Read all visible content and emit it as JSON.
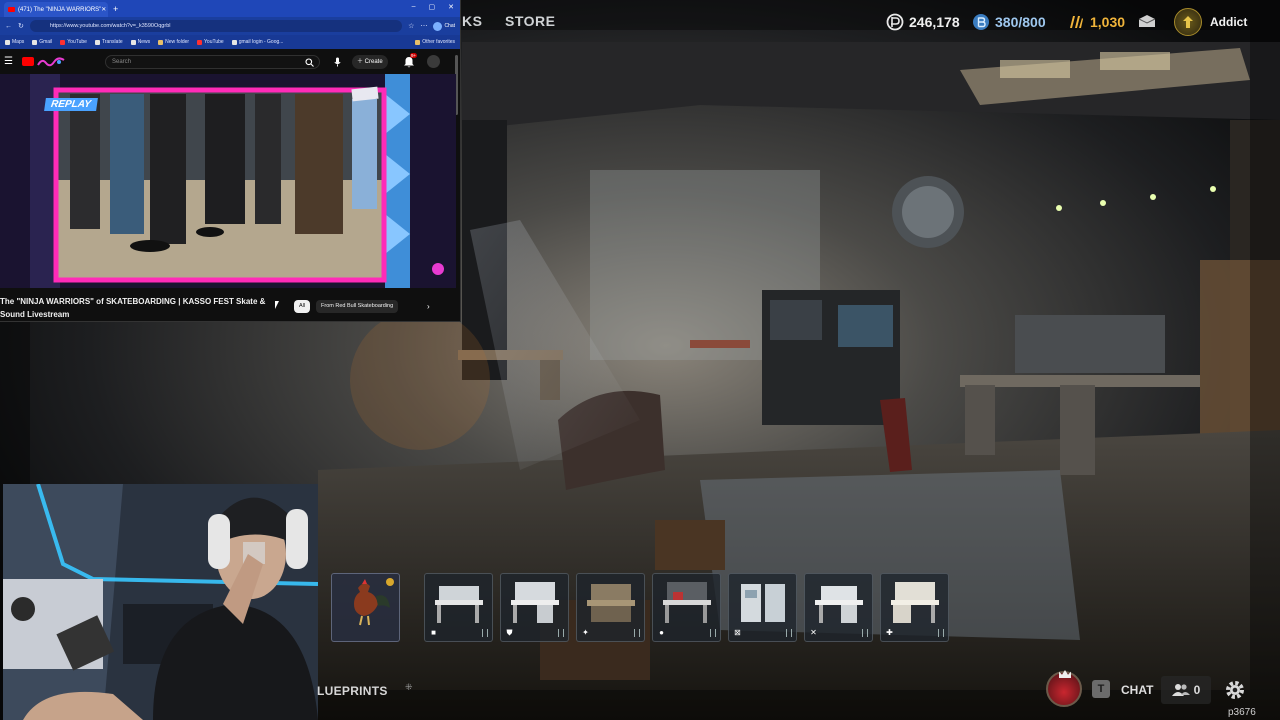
{
  "hud": {
    "nav_partial": "KS",
    "nav_store": "STORE",
    "currency_1_value": "246,178",
    "currency_2_value": "380/800",
    "currency_3_value": "1,030",
    "rank_name": "Addict",
    "icons": [
      "coin-icon",
      "bond-icon",
      "credit-icon",
      "mail-icon",
      "rank-icon"
    ]
  },
  "browser": {
    "tab_title": "(471) The \"NINJA WARRIORS\"",
    "new_tab": "+",
    "window_controls": [
      "–",
      "▢",
      "✕"
    ],
    "url": "https://www.youtube.com/watch?v=_k3590Oqgrbl",
    "profile_label": "Chat",
    "bookmarks": [
      "Maps",
      "Gmail",
      "YouTube",
      "Translate",
      "News",
      "New folder",
      "YouTube",
      "gmail login - Goog..."
    ],
    "other_bookmarks": "Other favorites",
    "youtube": {
      "search_placeholder": "Search",
      "create_label": "Create",
      "notif_count": "9+",
      "overlay_label": "REPLAY",
      "video_title": "The \"NINJA WARRIORS\" of SKATEBOARDING | KASSO FEST Skate & Sound Livestream",
      "chip_all": "All",
      "chip_channel": "From Red Bull Skateboarding",
      "chip_next": "›"
    }
  },
  "blueprints": {
    "label": "LUEPRINTS",
    "mark": "⁜",
    "slots": [
      {
        "name": "rooster",
        "perk": ""
      },
      {
        "name": "workbench-1",
        "perk": "■"
      },
      {
        "name": "workbench-2",
        "perk": "⛊"
      },
      {
        "name": "workbench-3",
        "perk": "✦"
      },
      {
        "name": "workbench-4",
        "perk": "●"
      },
      {
        "name": "workbench-5",
        "perk": "⊠"
      },
      {
        "name": "workbench-6",
        "perk": "✕"
      },
      {
        "name": "workbench-7",
        "perk": "✚"
      }
    ]
  },
  "social": {
    "chat_key": "T",
    "chat_label": "CHAT",
    "friends_count": "0",
    "user_tag": "p3676"
  },
  "colors": {
    "youtube_red": "#ff0000",
    "browser_blue": "#1f47b8",
    "replay_frame": "#ff2bb8",
    "gold": "#f0b43a"
  }
}
